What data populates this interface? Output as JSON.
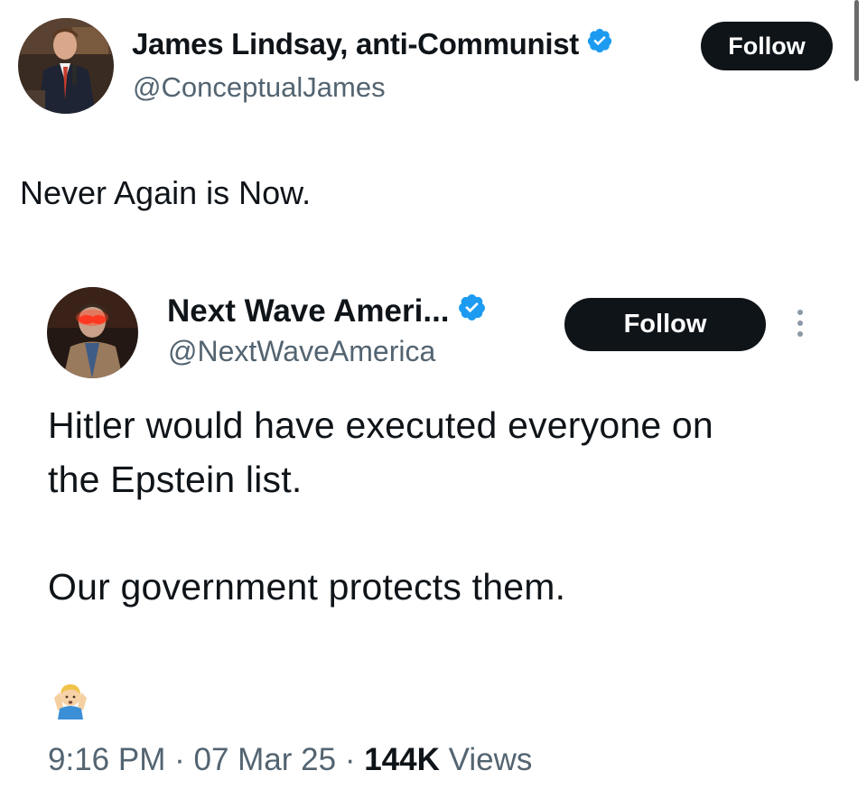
{
  "outer_tweet": {
    "author_name": "James Lindsay, anti-Communist",
    "author_handle": "@ConceptualJames",
    "follow_label": "Follow",
    "text": "Never Again is Now."
  },
  "quoted_tweet": {
    "author_name": "Next Wave Ameri...",
    "author_handle": "@NextWaveAmerica",
    "follow_label": "Follow",
    "lines": [
      "Hitler would have executed everyone on",
      "the Epstein list.",
      "Our government protects them."
    ],
    "emoji_icon": "person-shrugging-emoji",
    "time": "9:16 PM",
    "separator": "·",
    "date": "07 Mar 25",
    "views_count": "144K",
    "views_label": "Views"
  },
  "colors": {
    "verified_blue": "#1d9bf0",
    "follow_button_bg": "#0f1419",
    "secondary_text": "#536471"
  }
}
